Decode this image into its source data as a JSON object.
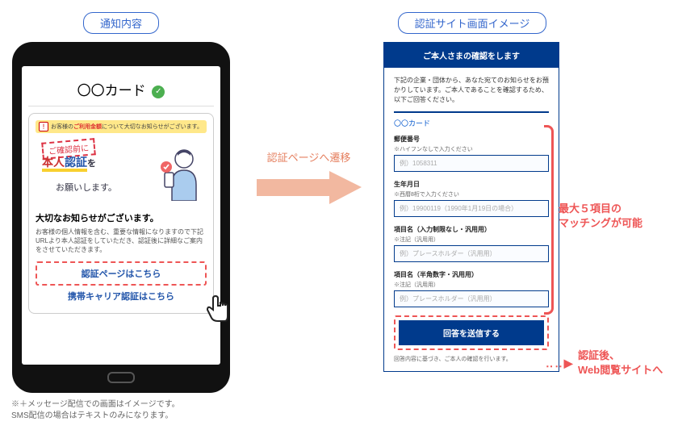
{
  "left": {
    "section_label": "通知内容",
    "phone_title": "〇〇カード",
    "warn_text": "お客様の",
    "warn_red": "ご利用金額",
    "warn_text2": "について大切なお知らせがございます。",
    "ribbon": "ご確認前に",
    "big_line1": "本人",
    "big_line1_blue": "認証",
    "big_line1_suffix": "を",
    "sub_text": "お願いします。",
    "notice_title": "大切なお知らせがございます。",
    "notice_body": "お客様の個人情報を含む、重要な情報になりますので下記URLより本人認証をしていただき、認証後に詳細なご案内をさせていただきます。",
    "link1": "認証ページはこちら",
    "link2": "携帯キャリア認証はこちら",
    "footnote": "※＋メッセージ配信での画面はイメージです。\nSMS配信の場合はテキストのみになります。"
  },
  "mid": {
    "arrow_label": "認証ページへ遷移"
  },
  "right": {
    "section_label": "認証サイト画面イメージ",
    "header": "ご本人さまの確認をします",
    "desc": "下記の企業・団体から、あなた宛てのお知らせをお預かりしています。ご本人であることを確認するため、以下ご回答ください。",
    "company": "〇〇カード",
    "fields": [
      {
        "label": "郵便番号",
        "hint": "※ハイフンなしで入力ください",
        "placeholder": "例）1058311"
      },
      {
        "label": "生年月日",
        "hint": "※西暦8桁で入力ください",
        "placeholder": "例）19900119（1990年1月19日の場合）"
      },
      {
        "label": "項目名（入力制限なし・汎用用）",
        "hint": "※注記（汎用用）",
        "placeholder": "例）プレースホルダー（汎用用）"
      },
      {
        "label": "項目名（半角数字・汎用用）",
        "hint": "※注記（汎用用）",
        "placeholder": "例）プレースホルダー（汎用用）"
      }
    ],
    "submit": "回答を送信する",
    "foot": "回答内容に基づき、ご本人の確認を行います。"
  },
  "annot": {
    "a1": "最大５項目の\nマッチングが可能",
    "a2": "認証後、\nWeb閲覧サイトへ"
  }
}
